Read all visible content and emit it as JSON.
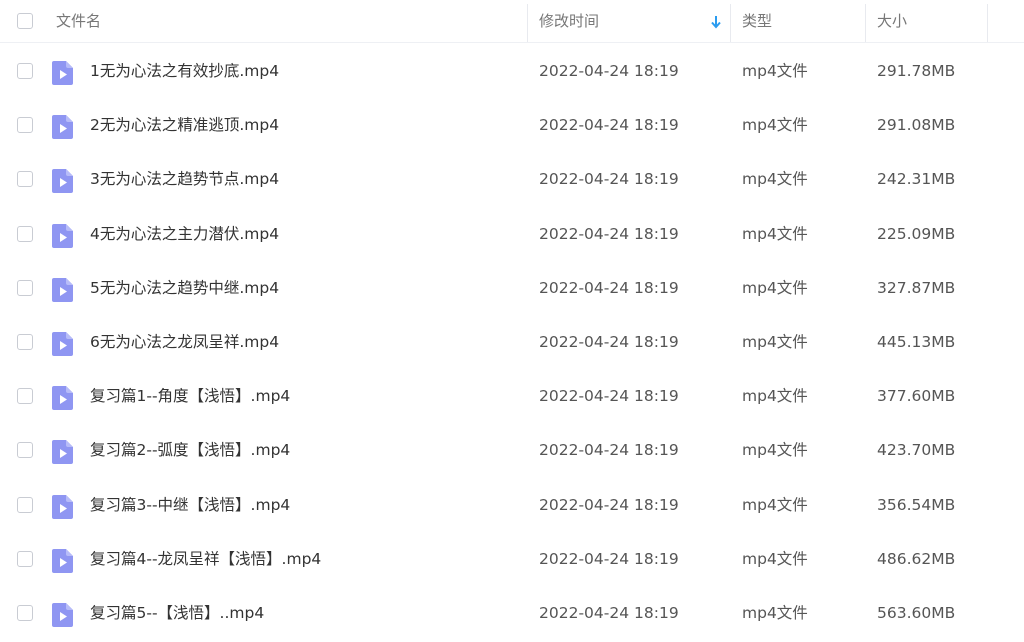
{
  "header": {
    "select_all_label": "",
    "col_name": "文件名",
    "col_modified": "修改时间",
    "col_type": "类型",
    "col_size": "大小",
    "sort_indicator": "arrow-down-icon",
    "accent_color": "#2a9cf0"
  },
  "icon_color": "#8f96f2",
  "files": [
    {
      "name": "1无为心法之有效抄底.mp4",
      "modified": "2022-04-24 18:19",
      "type": "mp4文件",
      "size": "291.78MB"
    },
    {
      "name": "2无为心法之精准逃顶.mp4",
      "modified": "2022-04-24 18:19",
      "type": "mp4文件",
      "size": "291.08MB"
    },
    {
      "name": "3无为心法之趋势节点.mp4",
      "modified": "2022-04-24 18:19",
      "type": "mp4文件",
      "size": "242.31MB"
    },
    {
      "name": "4无为心法之主力潜伏.mp4",
      "modified": "2022-04-24 18:19",
      "type": "mp4文件",
      "size": "225.09MB"
    },
    {
      "name": "5无为心法之趋势中继.mp4",
      "modified": "2022-04-24 18:19",
      "type": "mp4文件",
      "size": "327.87MB"
    },
    {
      "name": "6无为心法之龙凤呈祥.mp4",
      "modified": "2022-04-24 18:19",
      "type": "mp4文件",
      "size": "445.13MB"
    },
    {
      "name": "复习篇1--角度【浅悟】.mp4",
      "modified": "2022-04-24 18:19",
      "type": "mp4文件",
      "size": "377.60MB"
    },
    {
      "name": "复习篇2--弧度【浅悟】.mp4",
      "modified": "2022-04-24 18:19",
      "type": "mp4文件",
      "size": "423.70MB"
    },
    {
      "name": "复习篇3--中继【浅悟】.mp4",
      "modified": "2022-04-24 18:19",
      "type": "mp4文件",
      "size": "356.54MB"
    },
    {
      "name": "复习篇4--龙凤呈祥【浅悟】.mp4",
      "modified": "2022-04-24 18:19",
      "type": "mp4文件",
      "size": "486.62MB"
    },
    {
      "name": "复习篇5--【浅悟】..mp4",
      "modified": "2022-04-24 18:19",
      "type": "mp4文件",
      "size": "563.60MB"
    }
  ]
}
